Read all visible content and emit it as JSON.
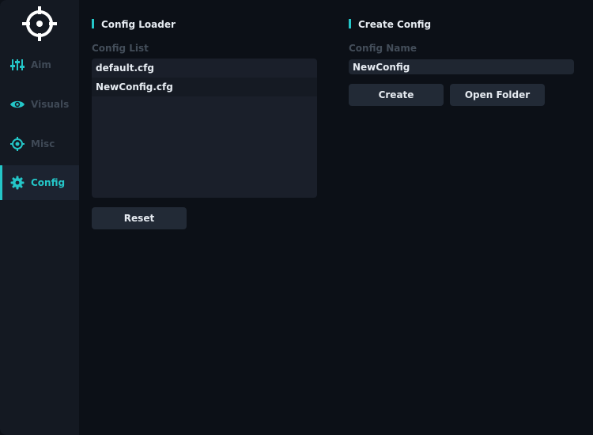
{
  "theme": {
    "accent": "#24c6c8",
    "sidebar_bg": "#141922",
    "main_bg": "#0c1017",
    "panel_bg": "#1a1f2a",
    "button_bg": "#222a36",
    "inactive_text": "#3f4956",
    "text": "#e6ebf1"
  },
  "sidebar": {
    "logo_icon": "crosshair-icon",
    "items": [
      {
        "label": "Aim",
        "icon": "sliders-icon",
        "active": false
      },
      {
        "label": "Visuals",
        "icon": "eye-icon",
        "active": false
      },
      {
        "label": "Misc",
        "icon": "target-icon",
        "active": false
      },
      {
        "label": "Config",
        "icon": "gear-icon",
        "active": true
      }
    ]
  },
  "config_loader": {
    "title": "Config Loader",
    "list_label": "Config List",
    "items": [
      "default.cfg",
      "NewConfig.cfg"
    ],
    "selected_index": 1,
    "reset_label": "Reset"
  },
  "create_config": {
    "title": "Create Config",
    "name_label": "Config Name",
    "name_value": "NewConfig",
    "create_label": "Create",
    "open_folder_label": "Open Folder"
  }
}
